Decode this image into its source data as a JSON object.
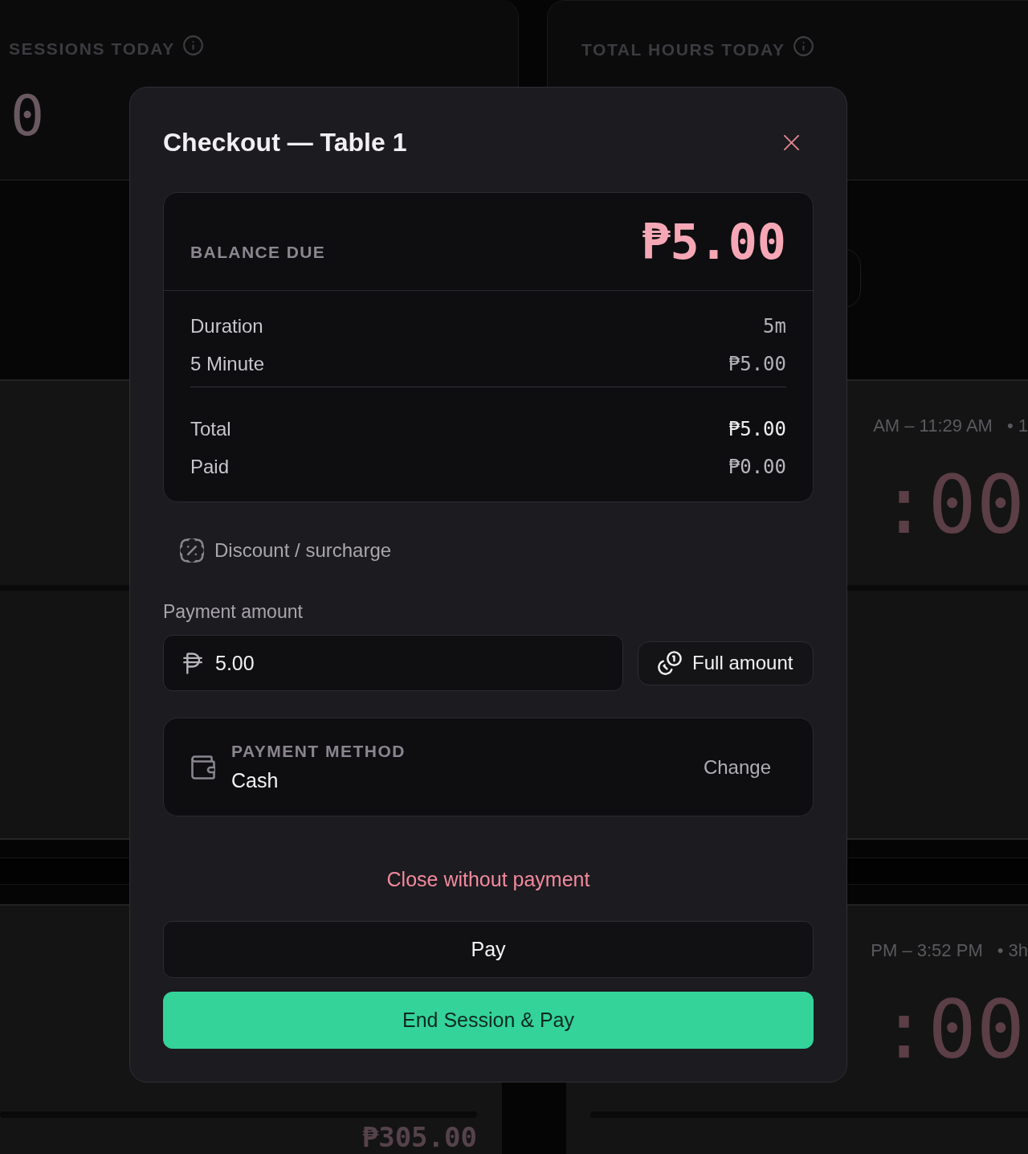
{
  "background": {
    "stats": [
      {
        "label": "SESSIONS TODAY",
        "value": "0"
      },
      {
        "label": "TOTAL HOURS TODAY"
      }
    ],
    "session_cards": [
      {
        "time_range": "AM – 11:29 AM",
        "duration": "• 1",
        "timer": ":00"
      },
      {
        "time_range": "PM – 3:52 PM",
        "duration": "• 3h",
        "timer": ":00"
      }
    ],
    "bottom_amount": "₱305.00"
  },
  "modal": {
    "title": "Checkout — Table 1",
    "summary": {
      "balance_label": "BALANCE DUE",
      "balance": "₱5.00",
      "lines": [
        {
          "label": "Duration",
          "value": "5m"
        },
        {
          "label": "5 Minute",
          "value": "₱5.00"
        }
      ],
      "totals": [
        {
          "label": "Total",
          "value": "₱5.00",
          "kind": "total"
        },
        {
          "label": "Paid",
          "value": "₱0.00",
          "kind": "paid"
        }
      ]
    },
    "discount_link": "Discount / surcharge",
    "payment_amount": {
      "label": "Payment amount",
      "value": "5.00"
    },
    "full_amount_button": "Full amount",
    "payment_method": {
      "label": "PAYMENT METHOD",
      "value": "Cash",
      "action": "Change"
    },
    "close_without_payment": "Close without payment",
    "buttons": [
      {
        "label": "Pay",
        "kind": "secondary"
      },
      {
        "label": "End Session & Pay",
        "kind": "primary"
      }
    ]
  }
}
